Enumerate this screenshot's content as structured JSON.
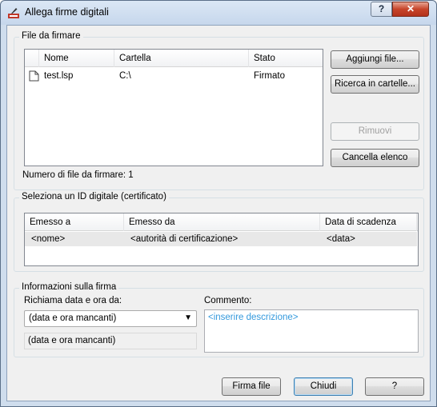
{
  "window": {
    "title": "Allega firme digitali",
    "help_button": "?",
    "close_button": "✕"
  },
  "files_group": {
    "legend": "File da firmare",
    "columns": [
      "Nome",
      "Cartella",
      "Stato"
    ],
    "rows": [
      {
        "name": "test.lsp",
        "folder": "C:\\",
        "status": "Firmato"
      }
    ],
    "count_label": "Numero di file da firmare: 1",
    "add_button": "Aggiungi file...",
    "search_button": "Ricerca in cartelle...",
    "remove_button": "Rimuovi",
    "clear_button": "Cancella elenco"
  },
  "cert_group": {
    "legend": "Seleziona un ID digitale (certificato)",
    "columns": [
      "Emesso a",
      "Emesso da",
      "Data di scadenza"
    ],
    "rows": [
      {
        "issued_to": "<nome>",
        "issued_by": "<autorità di certificazione>",
        "expiry": "<data>"
      }
    ]
  },
  "sig_group": {
    "legend": "Informazioni sulla firma",
    "time_label": "Richiama data e ora da:",
    "time_select_value": "(data e ora mancanti)",
    "time_readonly": "(data e ora mancanti)",
    "comment_label": "Commento:",
    "comment_placeholder": "<inserire descrizione>"
  },
  "footer": {
    "sign_button": "Firma file",
    "close_button": "Chiudi",
    "help_button": "?"
  },
  "colors": {
    "title_bar": "#cfdded",
    "close_red": "#c7442a",
    "placeholder_blue": "#3399dd",
    "selected_row": "#e8e8e8"
  }
}
